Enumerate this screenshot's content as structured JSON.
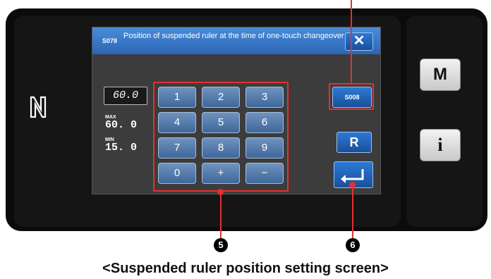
{
  "dialog": {
    "code": "S078",
    "title": "Position of suspended ruler at the time of one-touch changeover"
  },
  "value": {
    "current": "60.0",
    "max_label": "MAX",
    "max_value": "60. 0",
    "min_label": "MIN",
    "min_value": "15. 0"
  },
  "keypad": {
    "keys": [
      "1",
      "2",
      "3",
      "4",
      "5",
      "6",
      "7",
      "8",
      "9",
      "0",
      "+",
      "−"
    ]
  },
  "buttons": {
    "close": "✕",
    "s008": "S008",
    "r": "R",
    "m": "M",
    "info": "i"
  },
  "annotations": {
    "keypad_marker": "5",
    "enter_marker": "6"
  },
  "caption": "<Suspended ruler position setting screen>",
  "colors": {
    "accent": "#2b66b6",
    "annotation": "#e53030"
  }
}
